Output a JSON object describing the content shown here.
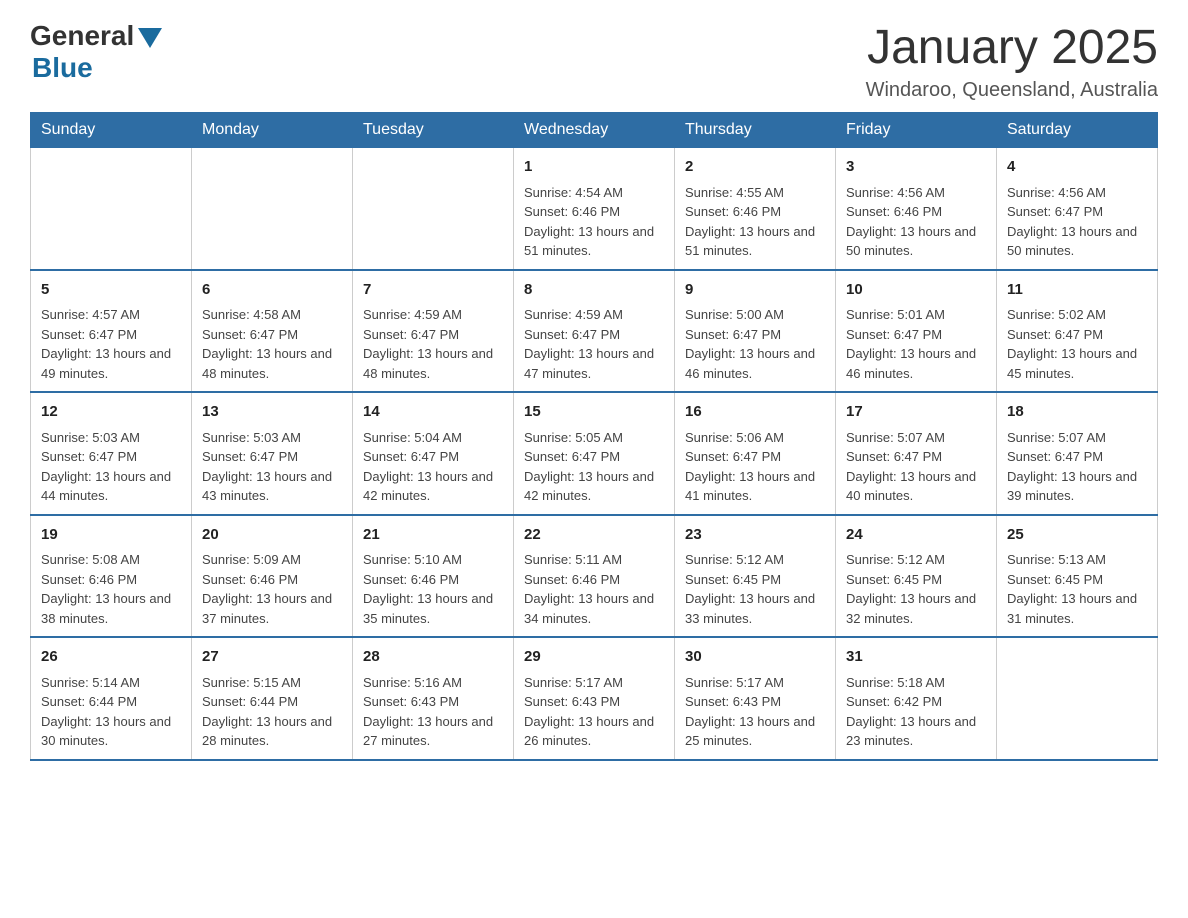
{
  "logo": {
    "general": "General",
    "blue": "Blue"
  },
  "title": "January 2025",
  "subtitle": "Windaroo, Queensland, Australia",
  "days_of_week": [
    "Sunday",
    "Monday",
    "Tuesday",
    "Wednesday",
    "Thursday",
    "Friday",
    "Saturday"
  ],
  "weeks": [
    [
      {
        "day": "",
        "info": ""
      },
      {
        "day": "",
        "info": ""
      },
      {
        "day": "",
        "info": ""
      },
      {
        "day": "1",
        "info": "Sunrise: 4:54 AM\nSunset: 6:46 PM\nDaylight: 13 hours and 51 minutes."
      },
      {
        "day": "2",
        "info": "Sunrise: 4:55 AM\nSunset: 6:46 PM\nDaylight: 13 hours and 51 minutes."
      },
      {
        "day": "3",
        "info": "Sunrise: 4:56 AM\nSunset: 6:46 PM\nDaylight: 13 hours and 50 minutes."
      },
      {
        "day": "4",
        "info": "Sunrise: 4:56 AM\nSunset: 6:47 PM\nDaylight: 13 hours and 50 minutes."
      }
    ],
    [
      {
        "day": "5",
        "info": "Sunrise: 4:57 AM\nSunset: 6:47 PM\nDaylight: 13 hours and 49 minutes."
      },
      {
        "day": "6",
        "info": "Sunrise: 4:58 AM\nSunset: 6:47 PM\nDaylight: 13 hours and 48 minutes."
      },
      {
        "day": "7",
        "info": "Sunrise: 4:59 AM\nSunset: 6:47 PM\nDaylight: 13 hours and 48 minutes."
      },
      {
        "day": "8",
        "info": "Sunrise: 4:59 AM\nSunset: 6:47 PM\nDaylight: 13 hours and 47 minutes."
      },
      {
        "day": "9",
        "info": "Sunrise: 5:00 AM\nSunset: 6:47 PM\nDaylight: 13 hours and 46 minutes."
      },
      {
        "day": "10",
        "info": "Sunrise: 5:01 AM\nSunset: 6:47 PM\nDaylight: 13 hours and 46 minutes."
      },
      {
        "day": "11",
        "info": "Sunrise: 5:02 AM\nSunset: 6:47 PM\nDaylight: 13 hours and 45 minutes."
      }
    ],
    [
      {
        "day": "12",
        "info": "Sunrise: 5:03 AM\nSunset: 6:47 PM\nDaylight: 13 hours and 44 minutes."
      },
      {
        "day": "13",
        "info": "Sunrise: 5:03 AM\nSunset: 6:47 PM\nDaylight: 13 hours and 43 minutes."
      },
      {
        "day": "14",
        "info": "Sunrise: 5:04 AM\nSunset: 6:47 PM\nDaylight: 13 hours and 42 minutes."
      },
      {
        "day": "15",
        "info": "Sunrise: 5:05 AM\nSunset: 6:47 PM\nDaylight: 13 hours and 42 minutes."
      },
      {
        "day": "16",
        "info": "Sunrise: 5:06 AM\nSunset: 6:47 PM\nDaylight: 13 hours and 41 minutes."
      },
      {
        "day": "17",
        "info": "Sunrise: 5:07 AM\nSunset: 6:47 PM\nDaylight: 13 hours and 40 minutes."
      },
      {
        "day": "18",
        "info": "Sunrise: 5:07 AM\nSunset: 6:47 PM\nDaylight: 13 hours and 39 minutes."
      }
    ],
    [
      {
        "day": "19",
        "info": "Sunrise: 5:08 AM\nSunset: 6:46 PM\nDaylight: 13 hours and 38 minutes."
      },
      {
        "day": "20",
        "info": "Sunrise: 5:09 AM\nSunset: 6:46 PM\nDaylight: 13 hours and 37 minutes."
      },
      {
        "day": "21",
        "info": "Sunrise: 5:10 AM\nSunset: 6:46 PM\nDaylight: 13 hours and 35 minutes."
      },
      {
        "day": "22",
        "info": "Sunrise: 5:11 AM\nSunset: 6:46 PM\nDaylight: 13 hours and 34 minutes."
      },
      {
        "day": "23",
        "info": "Sunrise: 5:12 AM\nSunset: 6:45 PM\nDaylight: 13 hours and 33 minutes."
      },
      {
        "day": "24",
        "info": "Sunrise: 5:12 AM\nSunset: 6:45 PM\nDaylight: 13 hours and 32 minutes."
      },
      {
        "day": "25",
        "info": "Sunrise: 5:13 AM\nSunset: 6:45 PM\nDaylight: 13 hours and 31 minutes."
      }
    ],
    [
      {
        "day": "26",
        "info": "Sunrise: 5:14 AM\nSunset: 6:44 PM\nDaylight: 13 hours and 30 minutes."
      },
      {
        "day": "27",
        "info": "Sunrise: 5:15 AM\nSunset: 6:44 PM\nDaylight: 13 hours and 28 minutes."
      },
      {
        "day": "28",
        "info": "Sunrise: 5:16 AM\nSunset: 6:43 PM\nDaylight: 13 hours and 27 minutes."
      },
      {
        "day": "29",
        "info": "Sunrise: 5:17 AM\nSunset: 6:43 PM\nDaylight: 13 hours and 26 minutes."
      },
      {
        "day": "30",
        "info": "Sunrise: 5:17 AM\nSunset: 6:43 PM\nDaylight: 13 hours and 25 minutes."
      },
      {
        "day": "31",
        "info": "Sunrise: 5:18 AM\nSunset: 6:42 PM\nDaylight: 13 hours and 23 minutes."
      },
      {
        "day": "",
        "info": ""
      }
    ]
  ]
}
